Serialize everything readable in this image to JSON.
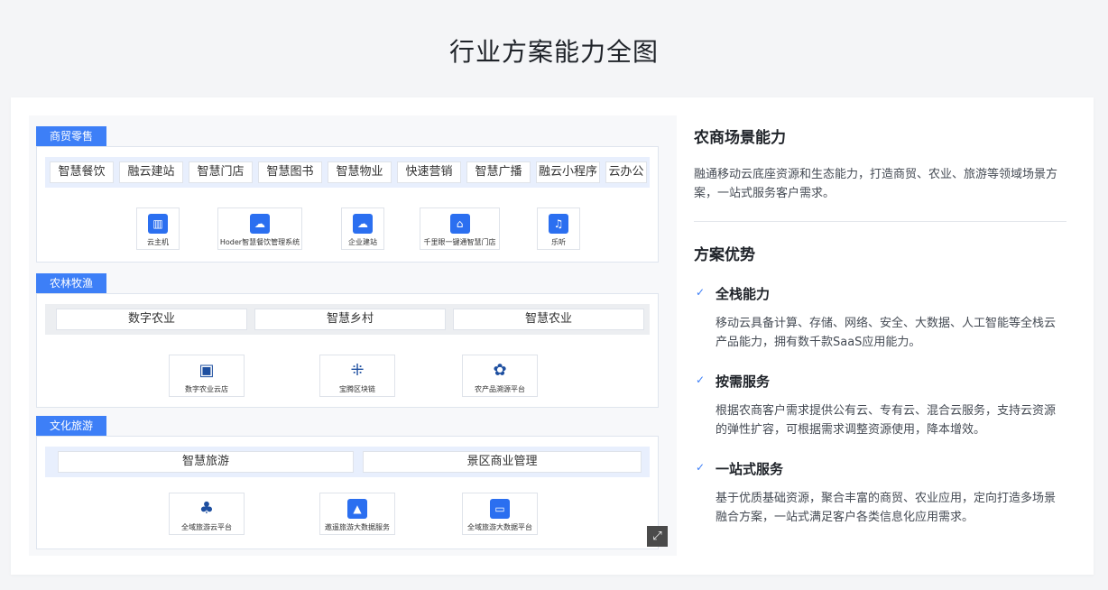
{
  "page_title": "行业方案能力全图",
  "diagram": {
    "categories": [
      {
        "tag": "商贸零售",
        "pills": [
          "智慧餐饮",
          "融云建站",
          "智慧门店",
          "智慧图书",
          "智慧物业",
          "快速营销",
          "智慧广播",
          "融云小程序",
          "云办公"
        ],
        "products": [
          {
            "label": "云主机",
            "icon": "server-icon"
          },
          {
            "label": "Hoder智慧餐饮管理系统",
            "icon": "cloud-flow-icon"
          },
          {
            "label": "企业建站",
            "icon": "cloud-icon"
          },
          {
            "label": "千里眼一键通智慧门店",
            "icon": "store-icon"
          },
          {
            "label": "乐听",
            "icon": "headphones-icon"
          }
        ]
      },
      {
        "tag": "农林牧渔",
        "pills": [
          "数字农业",
          "智慧乡村",
          "智慧农业"
        ],
        "products": [
          {
            "label": "数字农业云店",
            "icon": "shop-icon"
          },
          {
            "label": "宝腾区块链",
            "icon": "blockchain-icon"
          },
          {
            "label": "农产品溯源平台",
            "icon": "leaf-icon"
          }
        ]
      },
      {
        "tag": "文化旅游",
        "pills": [
          "智慧旅游",
          "景区商业管理"
        ],
        "products": [
          {
            "label": "全域旅游云平台",
            "icon": "palm-tree-icon"
          },
          {
            "label": "遨遥旅游大数据服务",
            "icon": "mountain-photo-icon"
          },
          {
            "label": "全域旅游大数据平台",
            "icon": "monitor-chart-icon"
          }
        ]
      }
    ]
  },
  "panel": {
    "title": "农商场景能力",
    "description": "融通移动云底座资源和生态能力，打造商贸、农业、旅游等领域场景方案，一站式服务客户需求。",
    "advantages_title": "方案优势",
    "advantages": [
      {
        "title": "全栈能力",
        "text": "移动云具备计算、存储、网络、安全、大数据、人工智能等全栈云产品能力，拥有数千款SaaS应用能力。"
      },
      {
        "title": "按需服务",
        "text": "根据农商客户需求提供公有云、专有云、混合云服务，支持云资源的弹性扩容，可根据需求调整资源使用，降本增效。"
      },
      {
        "title": "一站式服务",
        "text": "基于优质基础资源，聚合丰富的商贸、农业应用，定向打造多场景融合方案，一站式满足客户各类信息化应用需求。"
      }
    ]
  },
  "colors": {
    "accent": "#3d7ff7",
    "band_blue": "#e8effd",
    "band_gray": "#eceef1"
  }
}
